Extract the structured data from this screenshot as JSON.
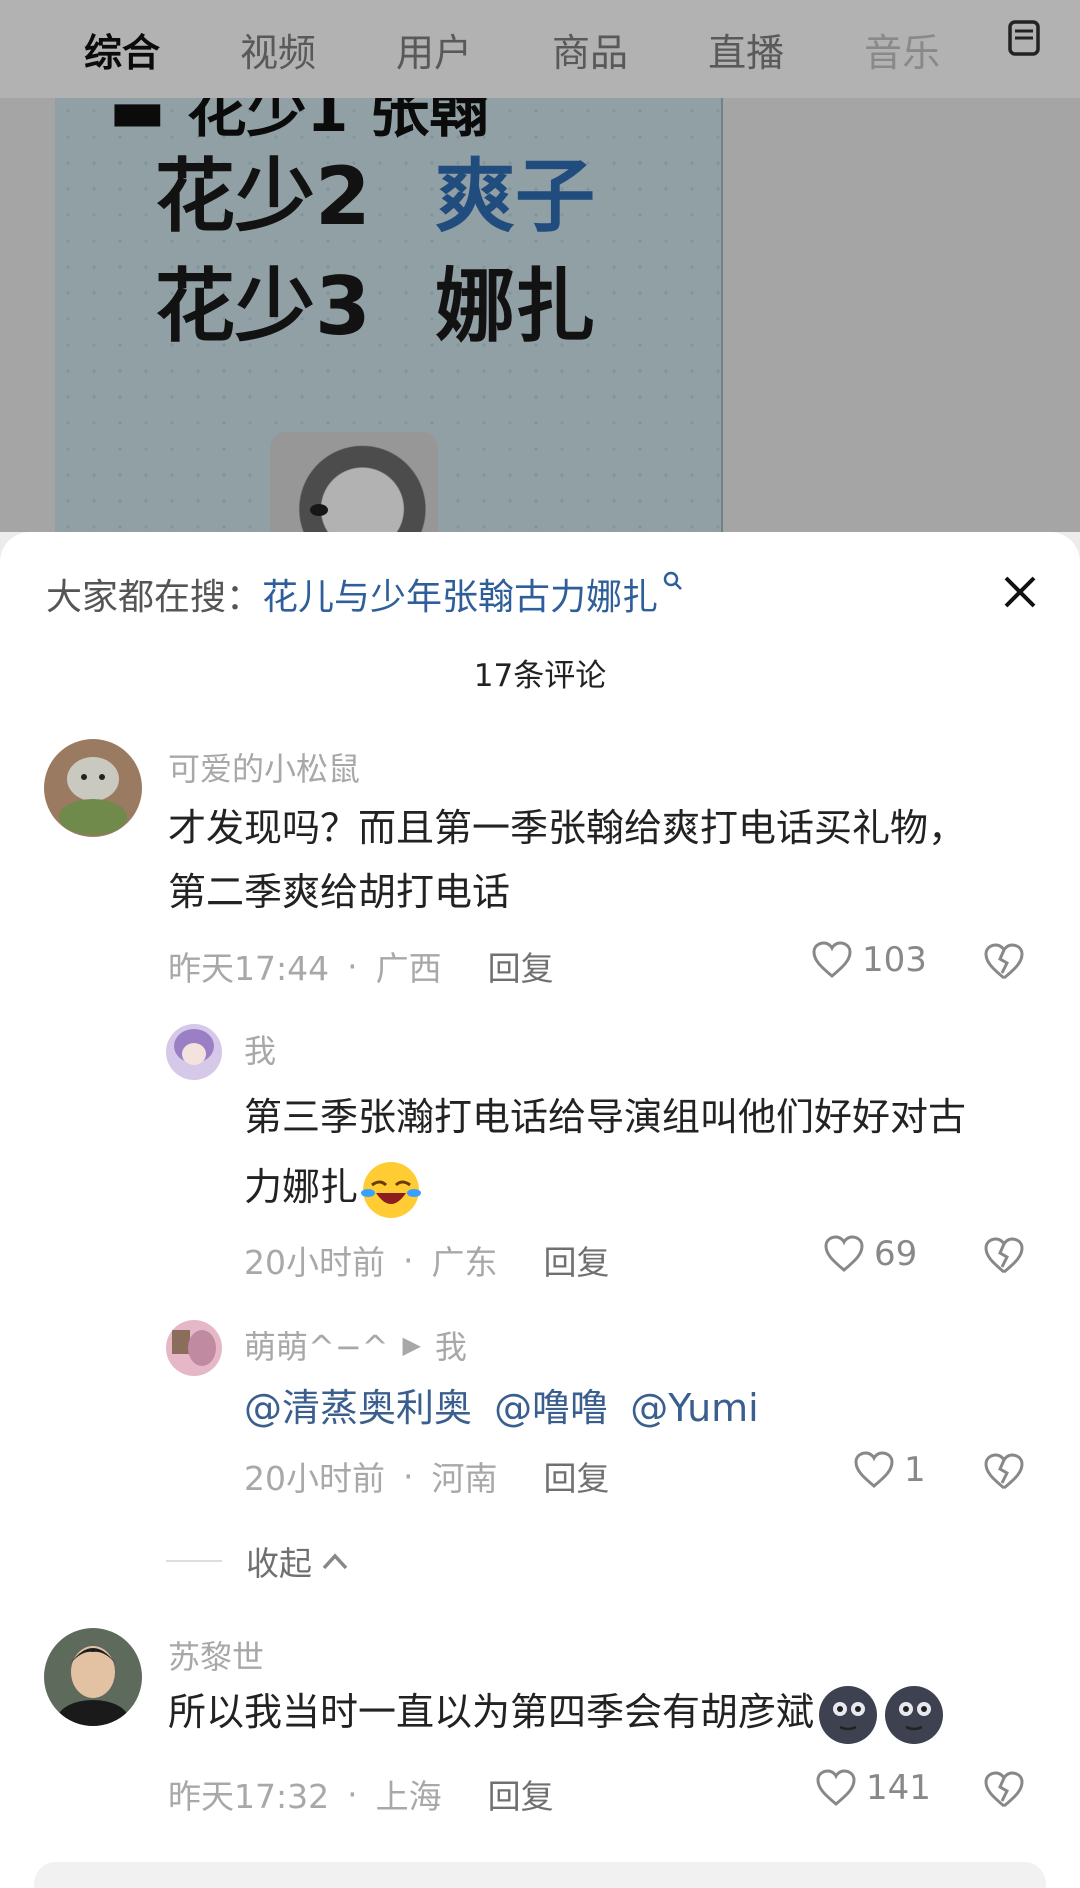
{
  "tabs": [
    {
      "label": "综合",
      "active": true
    },
    {
      "label": "视频"
    },
    {
      "label": "用户"
    },
    {
      "label": "商品"
    },
    {
      "label": "直播"
    },
    {
      "label": "音乐"
    }
  ],
  "video": {
    "top_partial": "▬ 花少1  张翰",
    "rows": [
      {
        "left": "花少2",
        "right": "爽子"
      },
      {
        "left": "花少3",
        "right": "娜扎"
      }
    ]
  },
  "sheet": {
    "trending_prefix": "大家都在搜：",
    "trending_query": "花儿与少年张翰古力娜扎",
    "comment_count": "17条评论",
    "reply_label": "回复",
    "collapse_label": "收起"
  },
  "comments": [
    {
      "user": "可爱的小松鼠",
      "text_line1": "才发现吗？而且第一季张翰给爽打电话买礼物，",
      "text_line2": "第二季爽给胡打电话",
      "time": "昨天17:44",
      "location": "广西",
      "likes": "103"
    },
    {
      "user": "我",
      "text_line1": "第三季张瀚打电话给导演组叫他们好好对古",
      "text_line2": "力娜扎",
      "time": "20小时前",
      "location": "广东",
      "likes": "69"
    },
    {
      "user": "萌萌^−^",
      "reply_to": "我",
      "mentions": [
        "@清蒸奥利奥",
        "@噜噜",
        "@Yumi"
      ],
      "time": "20小时前",
      "location": "河南",
      "likes": "1"
    },
    {
      "user": "苏黎世",
      "text_line1": "所以我当时一直以为第四季会有胡彦斌",
      "time": "昨天17:32",
      "location": "上海",
      "likes": "141"
    }
  ],
  "colors": {
    "link": "#2f5f9a",
    "muted": "#a8a8a8",
    "text": "#222222",
    "blue_highlight": "#2f6db5"
  }
}
